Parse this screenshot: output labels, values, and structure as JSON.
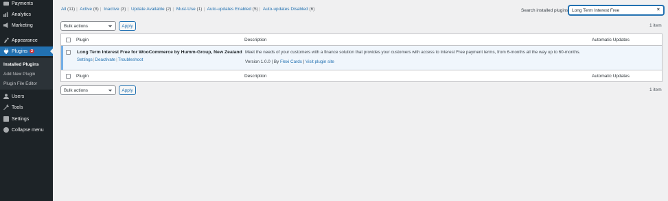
{
  "sidebar": {
    "items": [
      {
        "label": "Payments",
        "icon": "payments-icon"
      },
      {
        "label": "Analytics",
        "icon": "analytics-icon"
      },
      {
        "label": "Marketing",
        "icon": "marketing-icon"
      },
      {
        "label": "Appearance",
        "icon": "appearance-icon"
      },
      {
        "label": "Plugins",
        "icon": "plugins-icon",
        "badge": "2"
      },
      {
        "label": "Users",
        "icon": "users-icon"
      },
      {
        "label": "Tools",
        "icon": "tools-icon"
      },
      {
        "label": "Settings",
        "icon": "settings-icon"
      },
      {
        "label": "Collapse menu",
        "icon": "collapse-icon"
      }
    ],
    "submenu": [
      {
        "label": "Installed Plugins"
      },
      {
        "label": "Add New Plugin"
      },
      {
        "label": "Plugin File Editor"
      }
    ]
  },
  "filters": {
    "all": {
      "label": "All",
      "count": "(11)"
    },
    "active": {
      "label": "Active",
      "count": "(8)"
    },
    "inactive": {
      "label": "Inactive",
      "count": "(3)"
    },
    "update": {
      "label": "Update Available",
      "count": "(2)"
    },
    "mustuse": {
      "label": "Must-Use",
      "count": "(1)"
    },
    "autoenabled": {
      "label": "Auto-updates Enabled",
      "count": "(5)"
    },
    "autodisabled": {
      "label": "Auto-updates Disabled",
      "count": "(6)"
    },
    "separator": "|"
  },
  "search": {
    "label": "Search installed plugins",
    "value": "Long Term Interest Free",
    "clear": "×"
  },
  "bulk": {
    "label": "Bulk actions",
    "apply": "Apply",
    "count": "1 item"
  },
  "table": {
    "headers": {
      "plugin": "Plugin",
      "description": "Description",
      "autoupdates": "Automatic Updates"
    },
    "row": {
      "title": "Long Term Interest Free for WooCommerce by Humm-Group, New Zealand",
      "actions": {
        "settings": "Settings",
        "deactivate": "Deactivate",
        "troubleshoot": "Troubleshoot"
      },
      "description": "Meet the needs of your customers with a finance solution that provides your customers with access to Interest Free payment terms, from 6-months all the way up to 60-months.",
      "version": "Version 1.0.0",
      "by": "By",
      "author": "Flexi Cards",
      "site": "Visit plugin site"
    }
  },
  "colors": {
    "sidebar": "#1d2327",
    "accent": "#2271b1",
    "badge": "#d63638"
  }
}
